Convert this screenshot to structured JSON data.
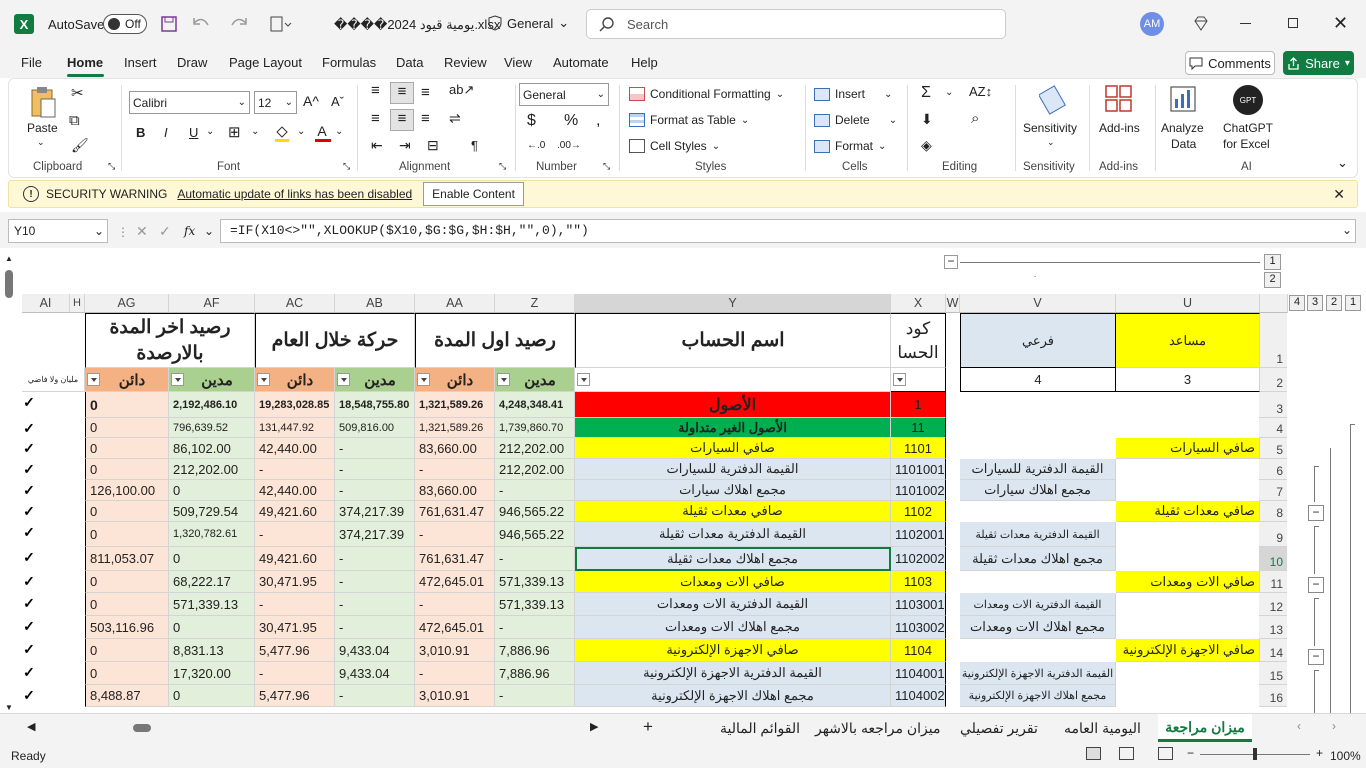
{
  "titlebar": {
    "autosave_label": "AutoSave",
    "autosave_state": "Off",
    "file_name": "����يومية قيود 2024.xlsx",
    "sensitivity": "General",
    "search_placeholder": "Search",
    "avatar": "AM"
  },
  "menu": [
    "File",
    "Home",
    "Insert",
    "Draw",
    "Page Layout",
    "Formulas",
    "Data",
    "Review",
    "View",
    "Automate",
    "Help"
  ],
  "actions": {
    "comments": "Comments",
    "share": "Share"
  },
  "ribbon": {
    "clipboard": {
      "paste": "Paste",
      "label": "Clipboard"
    },
    "font": {
      "name": "Calibri",
      "size": "12",
      "label": "Font"
    },
    "alignment": {
      "label": "Alignment"
    },
    "number": {
      "format": "General",
      "label": "Number"
    },
    "styles": {
      "conditional": "Conditional Formatting",
      "table": "Format as Table",
      "cell_styles": "Cell Styles",
      "label": "Styles"
    },
    "cells": {
      "insert": "Insert",
      "delete": "Delete",
      "format": "Format",
      "label": "Cells"
    },
    "editing": {
      "label": "Editing"
    },
    "sensitivity": {
      "btn": "Sensitivity",
      "label": "Sensitivity"
    },
    "addins": {
      "btn": "Add-ins",
      "label": "Add-ins"
    },
    "analyze": {
      "l1": "Analyze",
      "l2": "Data"
    },
    "ai": {
      "l1": "ChatGPT",
      "l2": "for Excel",
      "label": "AI",
      "logo": "GPT"
    }
  },
  "security": {
    "title": "SECURITY WARNING",
    "message": "Automatic update of links has been disabled",
    "button": "Enable Content"
  },
  "formula": {
    "namebox": "Y10",
    "fx": "fx",
    "text": "=IF(X10<>\"\",XLOOKUP($X10,$G:$G,$H:$H,\"\",0),\"\")"
  },
  "outline_levels": [
    "1",
    "2"
  ],
  "row_outline_levels": [
    "4",
    "3",
    "2",
    "1"
  ],
  "columns": [
    "AI",
    "H",
    "AG",
    "AF",
    "AC",
    "AB",
    "AA",
    "Z",
    "Y",
    "X",
    "W",
    "V",
    "U"
  ],
  "headers": {
    "end_balance": "رصيد اخر المدة بالارصدة",
    "period_movement": "حركة خلال العام",
    "start_balance": "رصيد اول المدة",
    "account_name": "اسم الحساب",
    "account_code": "كود الحسا",
    "sub": "فرعي",
    "assistant": "مساعد",
    "creditor": "دائن",
    "debtor": "مدين",
    "v2": "4",
    "u2": "3",
    "note": "مليان ولا فاضي"
  },
  "rows": [
    {
      "n": "3",
      "ag": "0",
      "af": "2,192,486.10",
      "ac": "19,283,028.85",
      "ab": "18,548,755.80",
      "aa": "1,321,589.26",
      "z": "4,248,348.41",
      "y": "الأصول",
      "x": "1"
    },
    {
      "n": "4",
      "ag": "0",
      "af": "796,639.52",
      "ac": "131,447.92",
      "ab": "509,816.00",
      "aa": "1,321,589.26",
      "z": "1,739,860.70",
      "y": "الأصول الغير متداولة",
      "x": "11"
    },
    {
      "n": "5",
      "ag": "0",
      "af": "86,102.00",
      "ac": "42,440.00",
      "ab": "-",
      "aa": "83,660.00",
      "z": "212,202.00",
      "y": "صافي السيارات",
      "x": "1101",
      "u": "صافي السيارات"
    },
    {
      "n": "6",
      "ag": "0",
      "af": "212,202.00",
      "ac": "-",
      "ab": "-",
      "aa": "-",
      "z": "212,202.00",
      "y": "القيمة الدفترية للسيارات",
      "x": "1101001",
      "v": "القيمة الدفترية للسيارات"
    },
    {
      "n": "7",
      "ag": "126,100.00",
      "af": "0",
      "ac": "42,440.00",
      "ab": "-",
      "aa": "83,660.00",
      "z": "-",
      "y": "مجمع اهلاك سيارات",
      "x": "1101002",
      "v": "مجمع اهلاك سيارات"
    },
    {
      "n": "8",
      "ag": "0",
      "af": "509,729.54",
      "ac": "49,421.60",
      "ab": "374,217.39",
      "aa": "761,631.47",
      "z": "946,565.22",
      "y": "صافي معدات ثقيلة",
      "x": "1102",
      "u": "صافي معدات ثقيلة"
    },
    {
      "n": "9",
      "ag": "0",
      "af": "1,320,782.61",
      "ac": "-",
      "ab": "374,217.39",
      "aa": "-",
      "z": "946,565.22",
      "y": "القيمة الدفترية معدات ثقيلة",
      "x": "1102001",
      "v": "القيمة الدفترية معدات ثقيلة"
    },
    {
      "n": "10",
      "ag": "811,053.07",
      "af": "0",
      "ac": "49,421.60",
      "ab": "-",
      "aa": "761,631.47",
      "z": "-",
      "y": "مجمع اهلاك معدات ثقيلة",
      "x": "1102002",
      "v": "مجمع اهلاك معدات ثقيلة"
    },
    {
      "n": "11",
      "ag": "0",
      "af": "68,222.17",
      "ac": "30,471.95",
      "ab": "-",
      "aa": "472,645.01",
      "z": "571,339.13",
      "y": "صافي الات ومعدات",
      "x": "1103",
      "u": "صافي الات ومعدات"
    },
    {
      "n": "12",
      "ag": "0",
      "af": "571,339.13",
      "ac": "-",
      "ab": "-",
      "aa": "-",
      "z": "571,339.13",
      "y": "القيمة الدفترية الات ومعدات",
      "x": "1103001",
      "v": "القيمة الدفترية الات ومعدات"
    },
    {
      "n": "13",
      "ag": "503,116.96",
      "af": "0",
      "ac": "30,471.95",
      "ab": "-",
      "aa": "472,645.01",
      "z": "-",
      "y": "مجمع اهلاك الات ومعدات",
      "x": "1103002",
      "v": "مجمع اهلاك الات ومعدات"
    },
    {
      "n": "14",
      "ag": "0",
      "af": "8,831.13",
      "ac": "5,477.96",
      "ab": "9,433.04",
      "aa": "3,010.91",
      "z": "7,886.96",
      "y": "صافي الاجهزة الإلكترونية",
      "x": "1104",
      "u": "صافي الاجهزة الإلكترونية"
    },
    {
      "n": "15",
      "ag": "0",
      "af": "17,320.00",
      "ac": "-",
      "ab": "9,433.04",
      "aa": "-",
      "z": "7,886.96",
      "y": "القيمة الدفترية الاجهزة الإلكترونية",
      "x": "1104001",
      "v": "القيمة الدفترية الاجهزة الإلكترونية"
    },
    {
      "n": "16",
      "ag": "8,488.87",
      "af": "0",
      "ac": "5,477.96",
      "ab": "-",
      "aa": "3,010.91",
      "z": "-",
      "y": "مجمع اهلاك الاجهزة الإلكترونية",
      "x": "1104002",
      "v": "مجمع اهلاك الاجهزة الإلكترونية"
    }
  ],
  "tabs": [
    "ميزان مراجعة",
    "اليومية العامه",
    "تقرير تفصيلي",
    "ميزان مراجعه بالاشهر",
    "القوائم المالية"
  ],
  "status": {
    "ready": "Ready",
    "zoom": "100%"
  }
}
